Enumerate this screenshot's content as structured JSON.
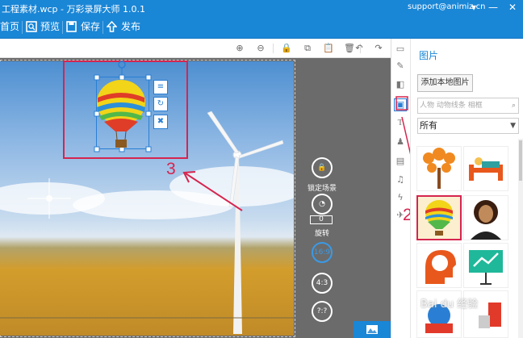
{
  "titlebar": {
    "title": "工程素材.wcp - 万彩录屏大师 1.0.1",
    "user": "support@animiz.cn",
    "min_label": "—",
    "close_label": "✕"
  },
  "toolbar": {
    "home": "首页",
    "preview": "预览",
    "save": "保存",
    "publish": "发布"
  },
  "canvas_tools": {
    "zoom_in": "⊕",
    "zoom_out": "⊖",
    "lock": "🔒",
    "copy": "⧉",
    "paste": "📋",
    "delete": "🗑",
    "undo": "↶",
    "redo": "↷"
  },
  "right_tools": {
    "lock_scene": "锁定场景",
    "rotate": "旋转",
    "rotate_value": "0",
    "ratio_169": "16:9",
    "ratio_43": "4:3",
    "ratio_custom": "?:?"
  },
  "panel": {
    "title": "图片",
    "add_local": "添加本地图片",
    "search_placeholder": "人物 动物线条 相框",
    "filter_value": "所有",
    "filter_arrow": "▼"
  },
  "annotations": {
    "one": "1",
    "two": "2",
    "three": "3"
  },
  "colors": {
    "brand": "#1a86d6",
    "annotation": "#d5254f",
    "selection": "#2a7fd4"
  },
  "watermark": "Bai du 经验"
}
